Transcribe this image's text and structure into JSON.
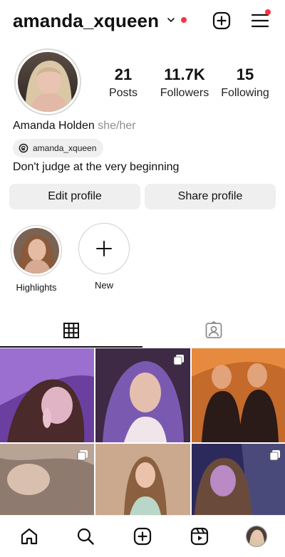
{
  "header": {
    "username": "amanda_xqueen",
    "icons": [
      "chevron-down-icon",
      "plus-square-icon",
      "menu-icon"
    ],
    "accent_color": "#ff3040"
  },
  "profile": {
    "posts_count": "21",
    "posts_label": "Posts",
    "followers_count": "11.7K",
    "followers_label": "Followers",
    "following_count": "15",
    "following_label": "Following",
    "name": "Amanda Holden",
    "pronouns": "she/her",
    "threads_handle": "amanda_xqueen",
    "bio": "Don't judge at the very beginning"
  },
  "actions": {
    "edit_profile": "Edit profile",
    "share_profile": "Share profile"
  },
  "highlights": [
    {
      "label": "Highlights"
    },
    {
      "label": "New"
    }
  ],
  "tabs": [
    "grid-icon",
    "tagged-icon"
  ],
  "grid_posts": [
    {
      "multi": false
    },
    {
      "multi": true
    },
    {
      "multi": false
    },
    {
      "multi": true
    },
    {
      "multi": false
    },
    {
      "multi": true
    }
  ],
  "bottom_nav": [
    "home-icon",
    "search-icon",
    "create-icon",
    "reels-icon",
    "profile-avatar"
  ]
}
